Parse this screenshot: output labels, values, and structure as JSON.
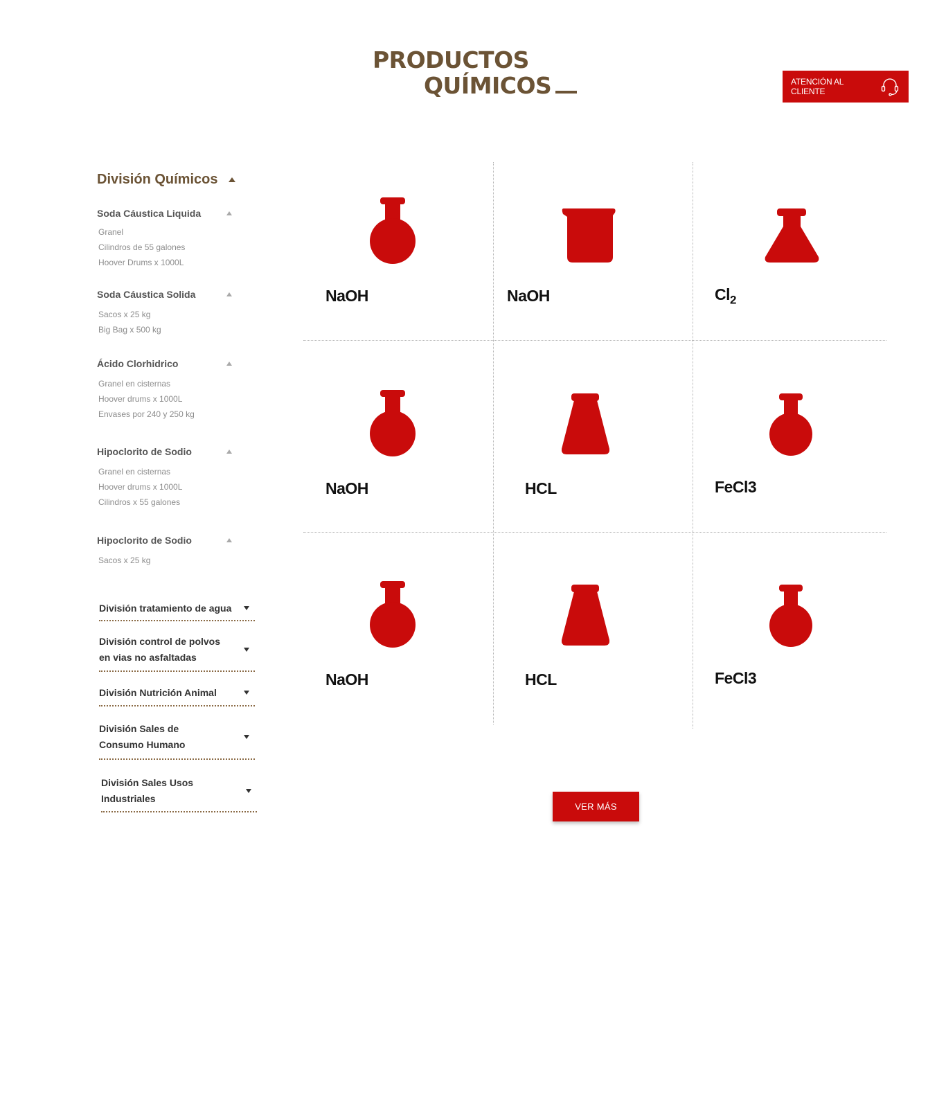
{
  "header": {
    "title_line1": "PRODUCTOS",
    "title_line2": "QUÍMICOS",
    "support_label": "ATENCIÓN AL CLIENTE"
  },
  "sidebar": {
    "title": "División Químicos",
    "groups": [
      {
        "label": "Soda Cáustica Liquida",
        "items": [
          "Granel",
          "Cilindros de 55 galones",
          "Hoover Drums x 1000L"
        ]
      },
      {
        "label": "Soda Cáustica Solida",
        "items": [
          "Sacos x 25 kg",
          "Big Bag x 500 kg"
        ]
      },
      {
        "label": "Ácido Clorhidrico",
        "items": [
          "Granel en cisternas",
          "Hoover drums x 1000L",
          "Envases por 240 y 250 kg"
        ]
      },
      {
        "label": "Hipoclorito de Sodio",
        "items": [
          "Granel en cisternas",
          "Hoover drums x 1000L",
          "Cilindros x 55 galones"
        ]
      },
      {
        "label": "Hipoclorito de Sodio",
        "items": [
          "Sacos x 25 kg"
        ]
      }
    ],
    "divisions": [
      {
        "label": "División tratamiento de agua"
      },
      {
        "label": "División control de polvos en vias no asfaltadas"
      },
      {
        "label": "División Nutrición Animal"
      },
      {
        "label": "División Sales de Consumo Humano"
      },
      {
        "label": "División Sales Usos Industriales"
      }
    ]
  },
  "products": [
    {
      "label": "NaOH",
      "icon": "round-flask-icon"
    },
    {
      "label": "NaOH",
      "icon": "beaker-icon"
    },
    {
      "label": "Cl",
      "sub": "2",
      "icon": "erlenmeyer-flask-icon"
    },
    {
      "label": "NaOH",
      "icon": "round-flask-icon"
    },
    {
      "label": "HCL",
      "icon": "conical-flask-icon"
    },
    {
      "label": "FeCl3",
      "icon": "round-flask-icon"
    },
    {
      "label": "NaOH",
      "icon": "round-flask-icon"
    },
    {
      "label": "HCL",
      "icon": "conical-flask-icon"
    },
    {
      "label": "FeCl3",
      "icon": "round-flask-icon"
    }
  ],
  "more_button": {
    "label": "VER MÁS"
  },
  "colors": {
    "brand_brown": "#6b5335",
    "accent_red": "#c90b0b"
  }
}
